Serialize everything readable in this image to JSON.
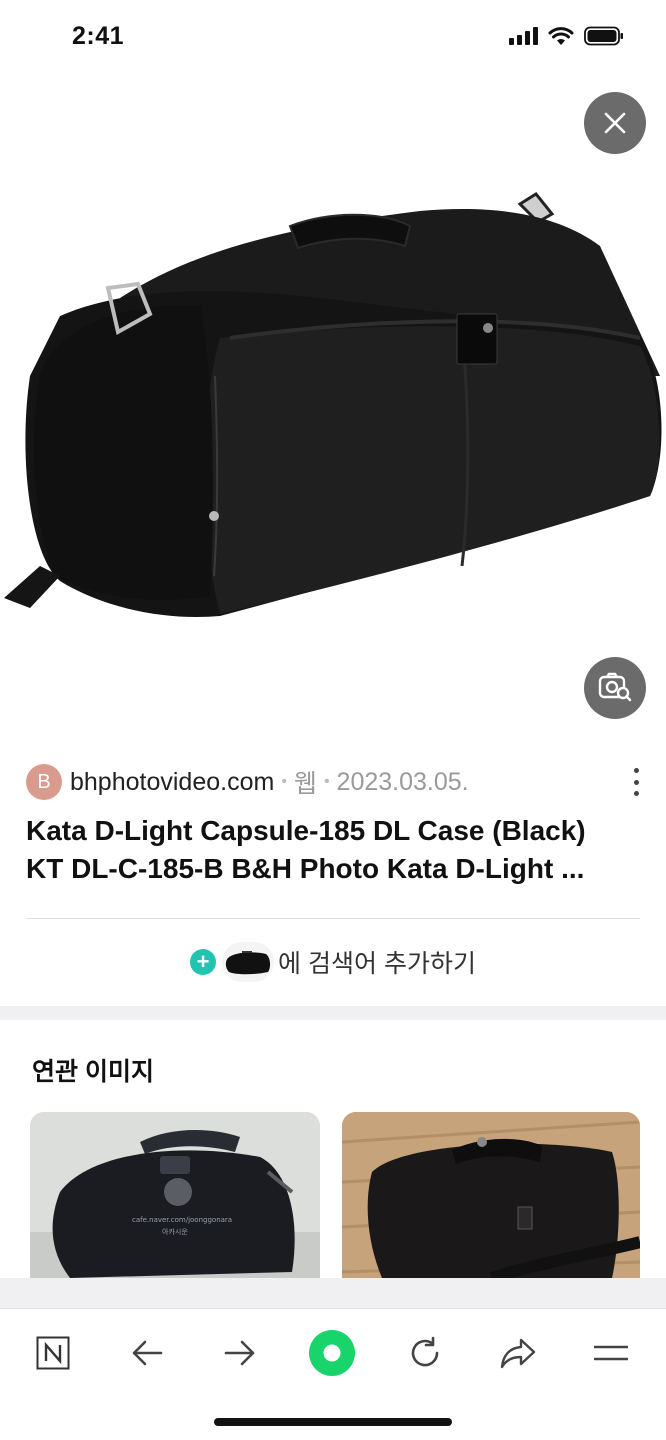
{
  "status_bar": {
    "time": "2:41"
  },
  "source": {
    "favicon_letter": "B",
    "domain": "bhphotovideo.com",
    "type": "웹",
    "date": "2023.03.05."
  },
  "result": {
    "title_line1": "Kata D-Light Capsule-185 DL Case (Black)",
    "title_line2": "KT DL-C-185-B B&H Photo Kata D-Light ..."
  },
  "add_search": {
    "label": "에 검색어 추가하기"
  },
  "related": {
    "title": "연관 이미지",
    "watermark_line1": "cafe.naver.com/joonggonara",
    "watermark_line2": "아카시운"
  },
  "toolbar": {
    "items": [
      "home-n-icon",
      "back-arrow-icon",
      "forward-arrow-icon",
      "green-dot-icon",
      "refresh-icon",
      "share-icon",
      "menu-icon"
    ]
  },
  "colors": {
    "overlay_button": "#6b6b6b",
    "accent_green": "#19d36b",
    "plus_teal": "#21c4b1",
    "favicon": "#d99b8e"
  }
}
